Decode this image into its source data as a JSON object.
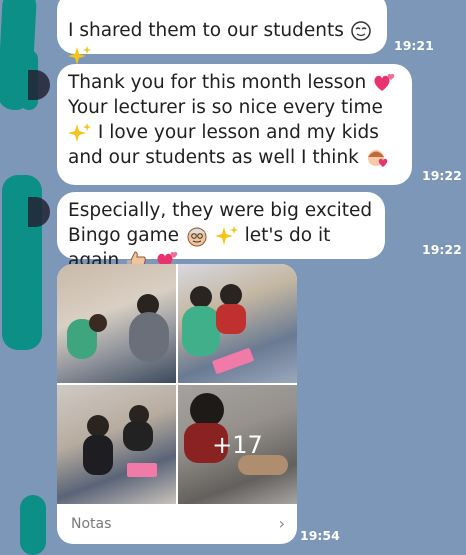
{
  "messages": [
    {
      "text": "I shared them to our students",
      "time": "19:21"
    },
    {
      "text_a": "Thank you for this month lesson",
      "text_b": "Your lecturer is so nice every time",
      "text_c": "I love your lesson and my kids and our students as well I think",
      "time": "19:22"
    },
    {
      "text_a": "Especially, they were big excited Bingo game",
      "text_b": "let's do it again",
      "time": "19:22"
    }
  ],
  "album": {
    "more_count": "+17",
    "notes_label": "Notas",
    "time": "19:54"
  },
  "icons": {
    "sparkle": "sparkles-icon",
    "heart": "two-hearts-icon",
    "face": "smiling-face-icon"
  },
  "colors": {
    "chat_background": "#7d97b8",
    "bubble": "#ffffff",
    "scribble": "#0b8f86"
  }
}
